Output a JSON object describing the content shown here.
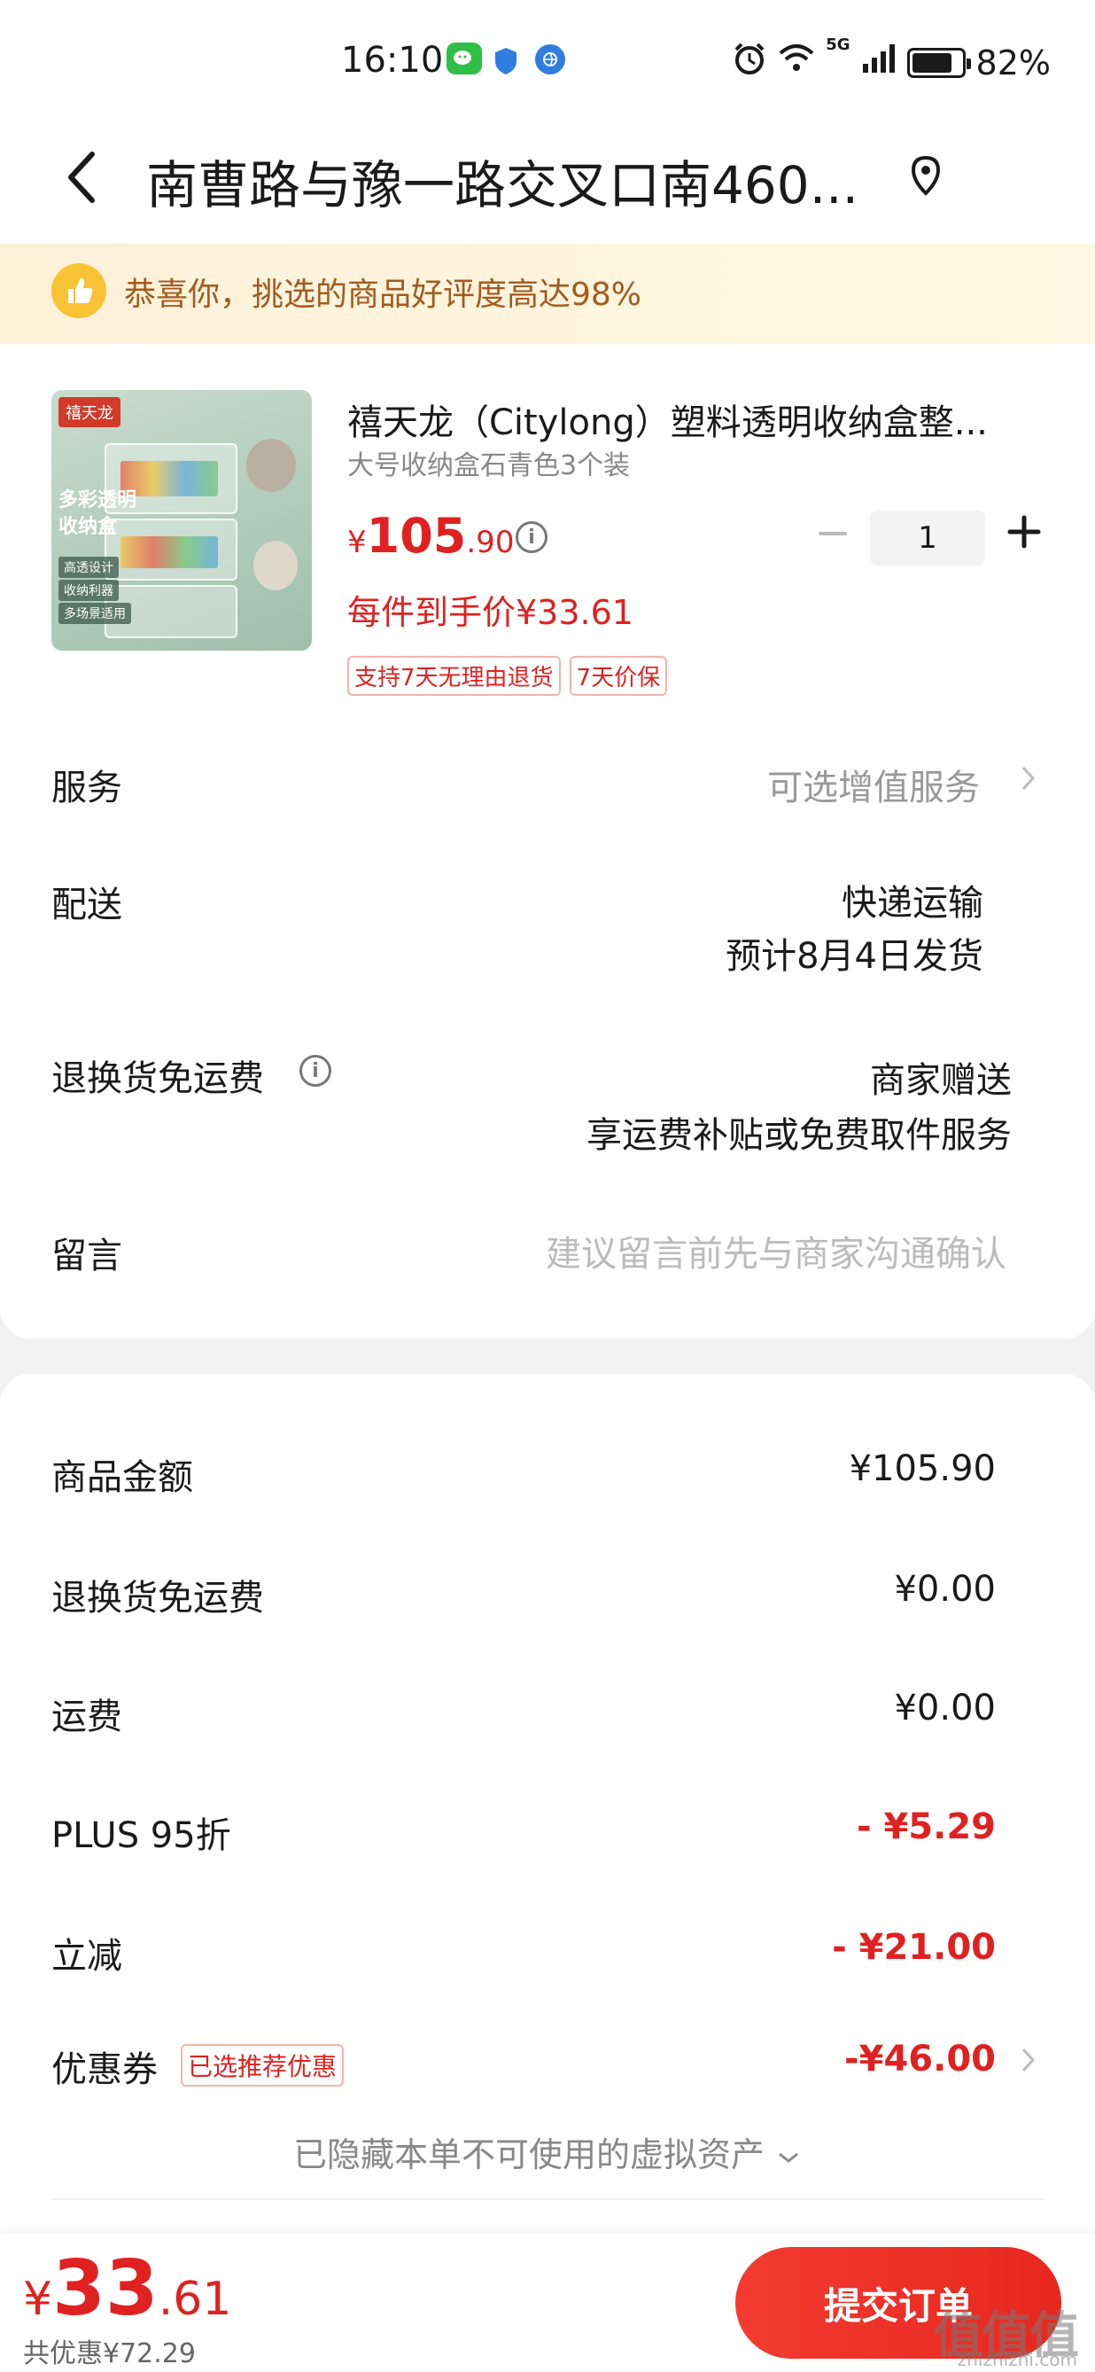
{
  "status_bar": {
    "time": "16:10",
    "battery": "82%",
    "battery_level": 0.82,
    "network": "5G"
  },
  "nav": {
    "title": "南曹路与豫一路交叉口南460..."
  },
  "banner": {
    "text": "恭喜你，挑选的商品好评度高达98%"
  },
  "product": {
    "image_brand": "禧天龙",
    "image_title_line1": "多彩透明",
    "image_title_line2": "收纳盒",
    "image_tags": [
      "高透设计",
      "收纳利器",
      "多场景适用"
    ],
    "name": "禧天龙（Citylong）塑料透明收纳盒整...",
    "spec": "大号收纳盒石青色3个装",
    "price_currency": "¥",
    "price_int": "105",
    "price_dec": ".90",
    "quantity": "1",
    "each_price": "每件到手价¥33.61",
    "tags": [
      "支持7天无理由退货",
      "7天价保"
    ]
  },
  "rows": {
    "service_label": "服务",
    "service_value": "可选增值服务",
    "delivery_label": "配送",
    "delivery_value1": "快递运输",
    "delivery_value2": "预计8月4日发货",
    "return_label": "退换货免运费",
    "return_value1": "商家赠送",
    "return_value2": "享运费补贴或免费取件服务",
    "message_label": "留言",
    "message_placeholder": "建议留言前先与商家沟通确认"
  },
  "summary": {
    "items": [
      {
        "label": "商品金额",
        "value": "¥105.90"
      },
      {
        "label": "退换货免运费",
        "value": "¥0.00"
      },
      {
        "label": "运费",
        "value": "¥0.00"
      },
      {
        "label": "PLUS 95折",
        "value": "- ¥5.29"
      },
      {
        "label": "立减",
        "value": "- ¥21.00"
      },
      {
        "label": "优惠券",
        "value": "-¥46.00"
      }
    ],
    "coupon_tag": "已选推荐优惠",
    "hidden_assets": "已隐藏本单不可使用的虚拟资产"
  },
  "bottom": {
    "currency": "¥",
    "total_int": "33",
    "total_dec": ".61",
    "saved": "共优惠¥72.29",
    "submit": "提交订单"
  },
  "watermark": {
    "main": "值值值",
    "sub": "zhizhizhi.com"
  },
  "colors": {
    "accent_red": "#e02121",
    "banner_text": "#a45a1f",
    "banner_bg": "#fdf2d8"
  }
}
